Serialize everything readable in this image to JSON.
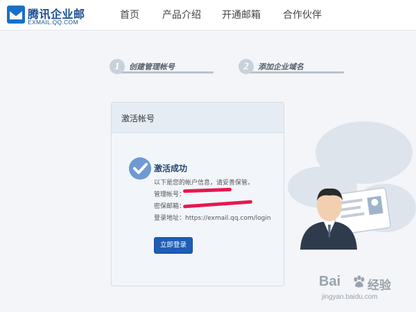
{
  "header": {
    "logo_title": "腾讯企业邮",
    "logo_subtitle": "EXMAIL.QQ.COM",
    "nav": {
      "home": "首页",
      "product": "产品介绍",
      "open_mailbox": "开通邮箱",
      "partner": "合作伙伴"
    }
  },
  "steps": [
    {
      "number": "1",
      "label": "创建管理帐号"
    },
    {
      "number": "2",
      "label": "添加企业域名"
    }
  ],
  "card": {
    "title": "激活帐号",
    "success_title": "激活成功",
    "tip": "以下是您的帐户信息，请妥善保管。",
    "admin_label": "管理帐号：",
    "email_label": "密保邮箱：",
    "url_label": "登录地址：",
    "url_value": "https://exmail.qq.com/login",
    "login_button": "立即登录"
  },
  "watermark": {
    "brand": "Bai",
    "brand2": "经验",
    "url": "jingyan.baidu.com"
  },
  "colors": {
    "brand_blue": "#1a4f93",
    "button_blue": "#1f5db6",
    "check_blue": "#6e9ad1",
    "redaction": "#e8174f"
  }
}
